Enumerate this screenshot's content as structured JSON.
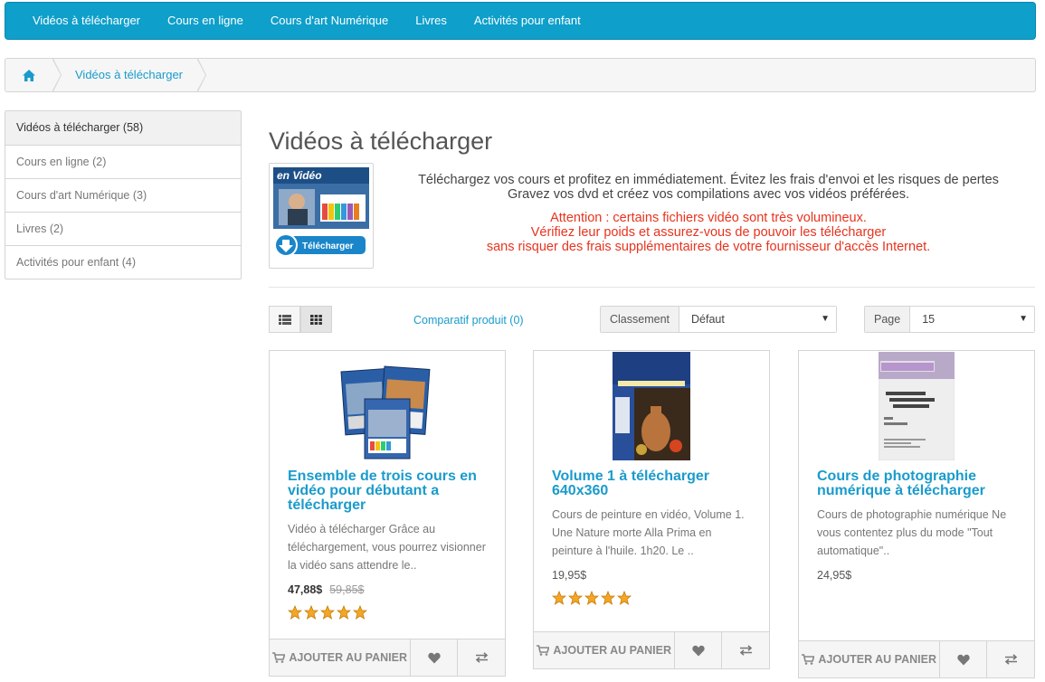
{
  "nav": {
    "items": [
      "Vidéos à télécharger",
      "Cours en ligne",
      "Cours d'art Numérique",
      "Livres",
      "Activités pour enfant"
    ]
  },
  "breadcrumb": {
    "current": "Vidéos à télécharger"
  },
  "sidebar": {
    "items": [
      "Vidéos à télécharger (58)",
      "Cours en ligne (2)",
      "Cours d'art Numérique (3)",
      "Livres (2)",
      "Activités pour enfant (4)"
    ]
  },
  "category": {
    "title": "Vidéos à télécharger",
    "description_line1": "Téléchargez vos cours et profitez en immédiatement. Évitez les frais d'envoi et les risques de pertes",
    "description_line2": "Gravez vos dvd et créez vos compilations avec vos vidéos préférées.",
    "warning_line1": "Attention : certains fichiers vidéo sont très volumineux.",
    "warning_line2": "Vérifiez leur poids et assurez-vous de pouvoir les télécharger",
    "warning_line3": "sans risquer des frais supplémentaires de votre fournisseur d'accès Internet.",
    "image_text_top": "en Vidéo",
    "image_button": "Télécharger"
  },
  "toolbar": {
    "compare": "Comparatif produit (0)",
    "sort_label": "Classement",
    "sort_value": "Défaut",
    "page_label": "Page",
    "page_value": "15"
  },
  "products": [
    {
      "title": "Ensemble de trois cours en vidéo pour débutant a télécharger",
      "desc": "Vidéo à télécharger Grâce au téléchargement, vous pourrez visionner la vidéo sans attendre le..",
      "price": "47,88$",
      "old_price": "59,85$",
      "rating": 5
    },
    {
      "title": "Volume 1 à télécharger 640x360",
      "desc": "Cours de peinture en vidéo, Volume 1. Une Nature morte Alla Prima en peinture à l'huile. 1h20. Le ..",
      "price": "19,95$",
      "rating": 5
    },
    {
      "title": "Cours de photographie numérique à télécharger",
      "desc": "Cours de photographie numérique Ne vous contentez plus du mode \"Tout automatique\"..",
      "price": "24,95$"
    }
  ],
  "cart_label": "AJOUTER AU PANIER",
  "colors": {
    "accent": "#0e9fcb",
    "link": "#1a9bcb",
    "warning": "#e8331e",
    "star": "#f5a623"
  },
  "icons": [
    "home-icon",
    "list-view-icon",
    "grid-view-icon",
    "cart-icon",
    "heart-icon",
    "compare-icon",
    "star-icon",
    "chevron-down-icon"
  ]
}
